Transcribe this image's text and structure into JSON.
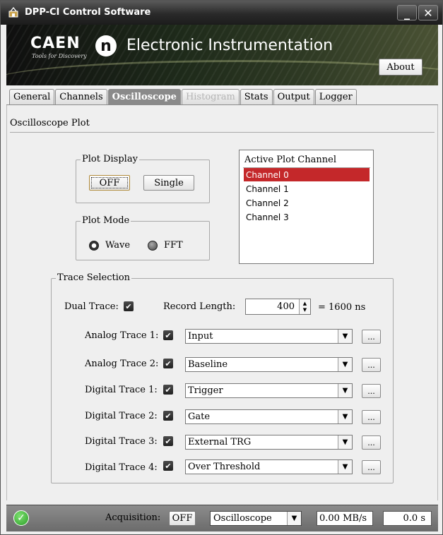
{
  "window": {
    "title": "DPP-CI Control Software",
    "minimize": "_",
    "close": "✕"
  },
  "banner": {
    "logo": "CAEN",
    "logo_sub": "Tools for Discovery",
    "logo_mark": "n",
    "title": "Electronic Instrumentation",
    "about_label": "About"
  },
  "tabs": [
    {
      "label": "General",
      "state": "normal"
    },
    {
      "label": "Channels",
      "state": "normal"
    },
    {
      "label": "Oscilloscope",
      "state": "active"
    },
    {
      "label": "Histogram",
      "state": "disabled"
    },
    {
      "label": "Stats",
      "state": "normal"
    },
    {
      "label": "Output",
      "state": "normal"
    },
    {
      "label": "Logger",
      "state": "normal"
    }
  ],
  "oscilloscope": {
    "section_title": "Oscilloscope Plot",
    "plot_display": {
      "label": "Plot Display",
      "off_label": "OFF",
      "single_label": "Single"
    },
    "plot_mode": {
      "label": "Plot Mode",
      "wave_label": "Wave",
      "fft_label": "FFT",
      "selected": "Wave"
    },
    "active_plot": {
      "label": "Active Plot  Channel",
      "channels": [
        "Channel 0",
        "Channel 1",
        "Channel 2",
        "Channel 3"
      ],
      "selected": "Channel 0"
    },
    "trace_selection": {
      "label": "Trace Selection",
      "dual_trace_label": "Dual Trace:",
      "dual_trace_checked": true,
      "record_length_label": "Record Length:",
      "record_length_value": "400",
      "record_length_ns": "= 1600 ns",
      "traces": [
        {
          "label": "Analog Trace 1:",
          "value": "Input",
          "checked": true,
          "more": "..."
        },
        {
          "label": "Analog Trace 2:",
          "value": "Baseline",
          "checked": true,
          "more": "..."
        },
        {
          "label": "Digital Trace 1:",
          "value": "Trigger",
          "checked": true,
          "more": "..."
        },
        {
          "label": "Digital Trace 2:",
          "value": "Gate",
          "checked": true,
          "more": "..."
        },
        {
          "label": "Digital Trace 3:",
          "value": "External TRG",
          "checked": true,
          "more": "..."
        },
        {
          "label": "Digital Trace 4:",
          "value": "Over Threshold",
          "checked": true,
          "more": "..."
        }
      ]
    }
  },
  "statusbar": {
    "acquisition_label": "Acquisition:",
    "acquisition_button": "OFF",
    "mode_value": "Oscilloscope",
    "rate": "0.00 MB/s",
    "time": "0.0 s"
  },
  "colors": {
    "selection": "#c4282a",
    "status_ok": "#2d9d2a",
    "active_tab": "#8a8a8a"
  }
}
